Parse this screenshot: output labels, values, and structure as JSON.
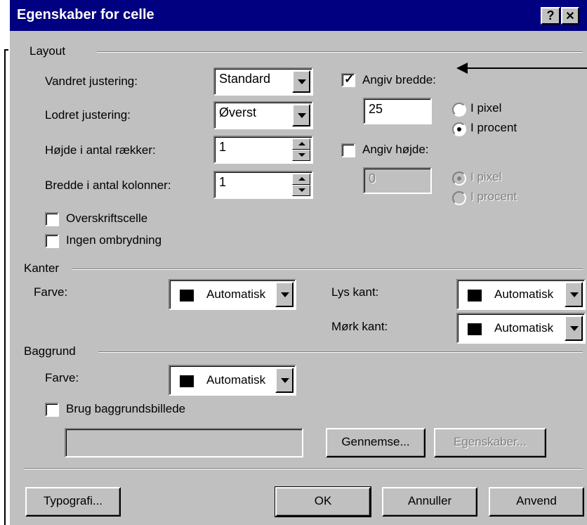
{
  "dialog": {
    "title": "Egenskaber for celle",
    "help_glyph": "?",
    "close_glyph": "✕"
  },
  "layout": {
    "group_label": "Layout",
    "horizontal_align_label": "Vandret justering:",
    "horizontal_align_value": "Standard",
    "vertical_align_label": "Lodret justering:",
    "vertical_align_value": "Øverst",
    "row_span_label": "Højde i antal rækker:",
    "row_span_value": "1",
    "col_span_label": "Bredde i antal kolonner:",
    "col_span_value": "1",
    "header_cell_label": "Overskriftscelle",
    "header_cell_checked": false,
    "no_wrap_label": "Ingen ombrydning",
    "no_wrap_checked": false,
    "width_check_label": "Angiv bredde:",
    "width_checked": true,
    "width_value": "25",
    "width_pixel_label": "I pixel",
    "width_percent_label": "I procent",
    "width_unit_selected": "percent",
    "height_check_label": "Angiv højde:",
    "height_checked": false,
    "height_value": "0",
    "height_pixel_label": "I pixel",
    "height_percent_label": "I procent",
    "height_unit_selected": "pixel"
  },
  "borders": {
    "group_label": "Kanter",
    "color_label": "Farve:",
    "color_value": "Automatisk",
    "light_label": "Lys kant:",
    "light_value": "Automatisk",
    "dark_label": "Mørk kant:",
    "dark_value": "Automatisk"
  },
  "background": {
    "group_label": "Baggrund",
    "color_label": "Farve:",
    "color_value": "Automatisk",
    "use_image_label": "Brug baggrundsbillede",
    "use_image_checked": false,
    "image_path": "",
    "browse_button": "Gennemse...",
    "properties_button": "Egenskaber..."
  },
  "footer": {
    "style_button": "Typografi...",
    "ok_button": "OK",
    "cancel_button": "Annuller",
    "apply_button": "Anvend"
  },
  "colors": {
    "titlebar": "#000080",
    "dialog_face": "#c0c0c0"
  }
}
